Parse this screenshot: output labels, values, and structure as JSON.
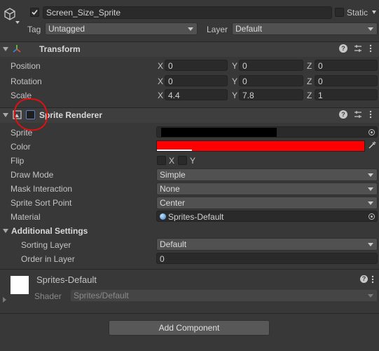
{
  "gameobject": {
    "name": "Screen_Size_Sprite",
    "active_checked": true,
    "static_label": "Static",
    "tag_label": "Tag",
    "tag_value": "Untagged",
    "layer_label": "Layer",
    "layer_value": "Default"
  },
  "transform": {
    "title": "Transform",
    "position_label": "Position",
    "rotation_label": "Rotation",
    "scale_label": "Scale",
    "axis_x": "X",
    "axis_y": "Y",
    "axis_z": "Z",
    "position": {
      "x": "0",
      "y": "0",
      "z": "0"
    },
    "rotation": {
      "x": "0",
      "y": "0",
      "z": "0"
    },
    "scale": {
      "x": "4.4",
      "y": "7.8",
      "z": "1"
    }
  },
  "sprite_renderer": {
    "title": "Sprite Renderer",
    "sprite_label": "Sprite",
    "sprite_value": "",
    "color_label": "Color",
    "color_value": "#ff0000",
    "flip_label": "Flip",
    "flip_x": "X",
    "flip_y": "Y",
    "draw_mode_label": "Draw Mode",
    "draw_mode_value": "Simple",
    "mask_label": "Mask Interaction",
    "mask_value": "None",
    "sort_point_label": "Sprite Sort Point",
    "sort_point_value": "Center",
    "material_label": "Material",
    "material_value": "Sprites-Default",
    "additional_settings": "Additional Settings",
    "sorting_layer_label": "Sorting Layer",
    "sorting_layer_value": "Default",
    "order_label": "Order in Layer",
    "order_value": "0",
    "annotation_color": "#e01010"
  },
  "material_preview": {
    "name": "Sprites-Default",
    "shader_label": "Shader",
    "shader_value": "Sprites/Default"
  },
  "footer": {
    "add_component": "Add Component"
  }
}
